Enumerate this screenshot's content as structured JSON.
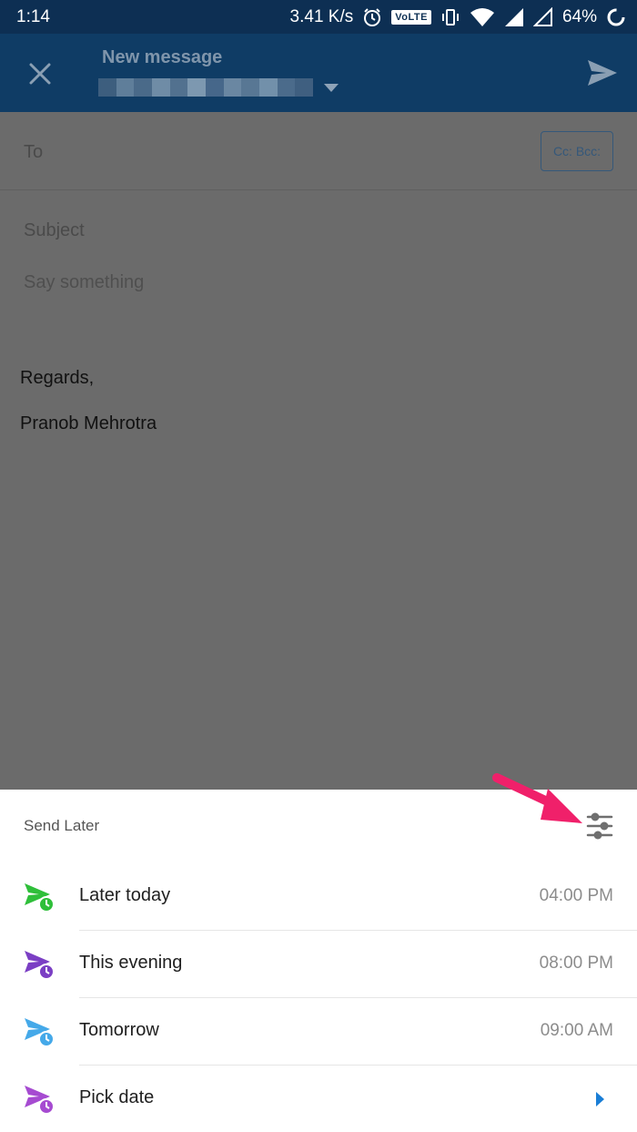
{
  "status_bar": {
    "time": "1:14",
    "net_speed": "3.41 K/s",
    "volte": "VoLTE",
    "battery": "64%"
  },
  "app_bar": {
    "title": "New message"
  },
  "compose": {
    "to_label": "To",
    "cc_bcc_label": "Cc: Bcc:",
    "subject_placeholder": "Subject",
    "body_placeholder": "Say something",
    "signature_line1": "Regards,",
    "signature_line2": "Pranob Mehrotra"
  },
  "send_later": {
    "title": "Send Later",
    "options": [
      {
        "label": "Later today",
        "time": "04:00 PM",
        "icon_color": "#2fbf3a"
      },
      {
        "label": "This evening",
        "time": "08:00 PM",
        "icon_color": "#7b3fc4"
      },
      {
        "label": "Tomorrow",
        "time": "09:00 AM",
        "icon_color": "#45a9e9"
      },
      {
        "label": "Pick date",
        "time": "",
        "icon_color": "#a64bd1"
      }
    ]
  },
  "colors": {
    "accent_blue": "#1a7ed6",
    "annotation_arrow": "#f0206a"
  }
}
